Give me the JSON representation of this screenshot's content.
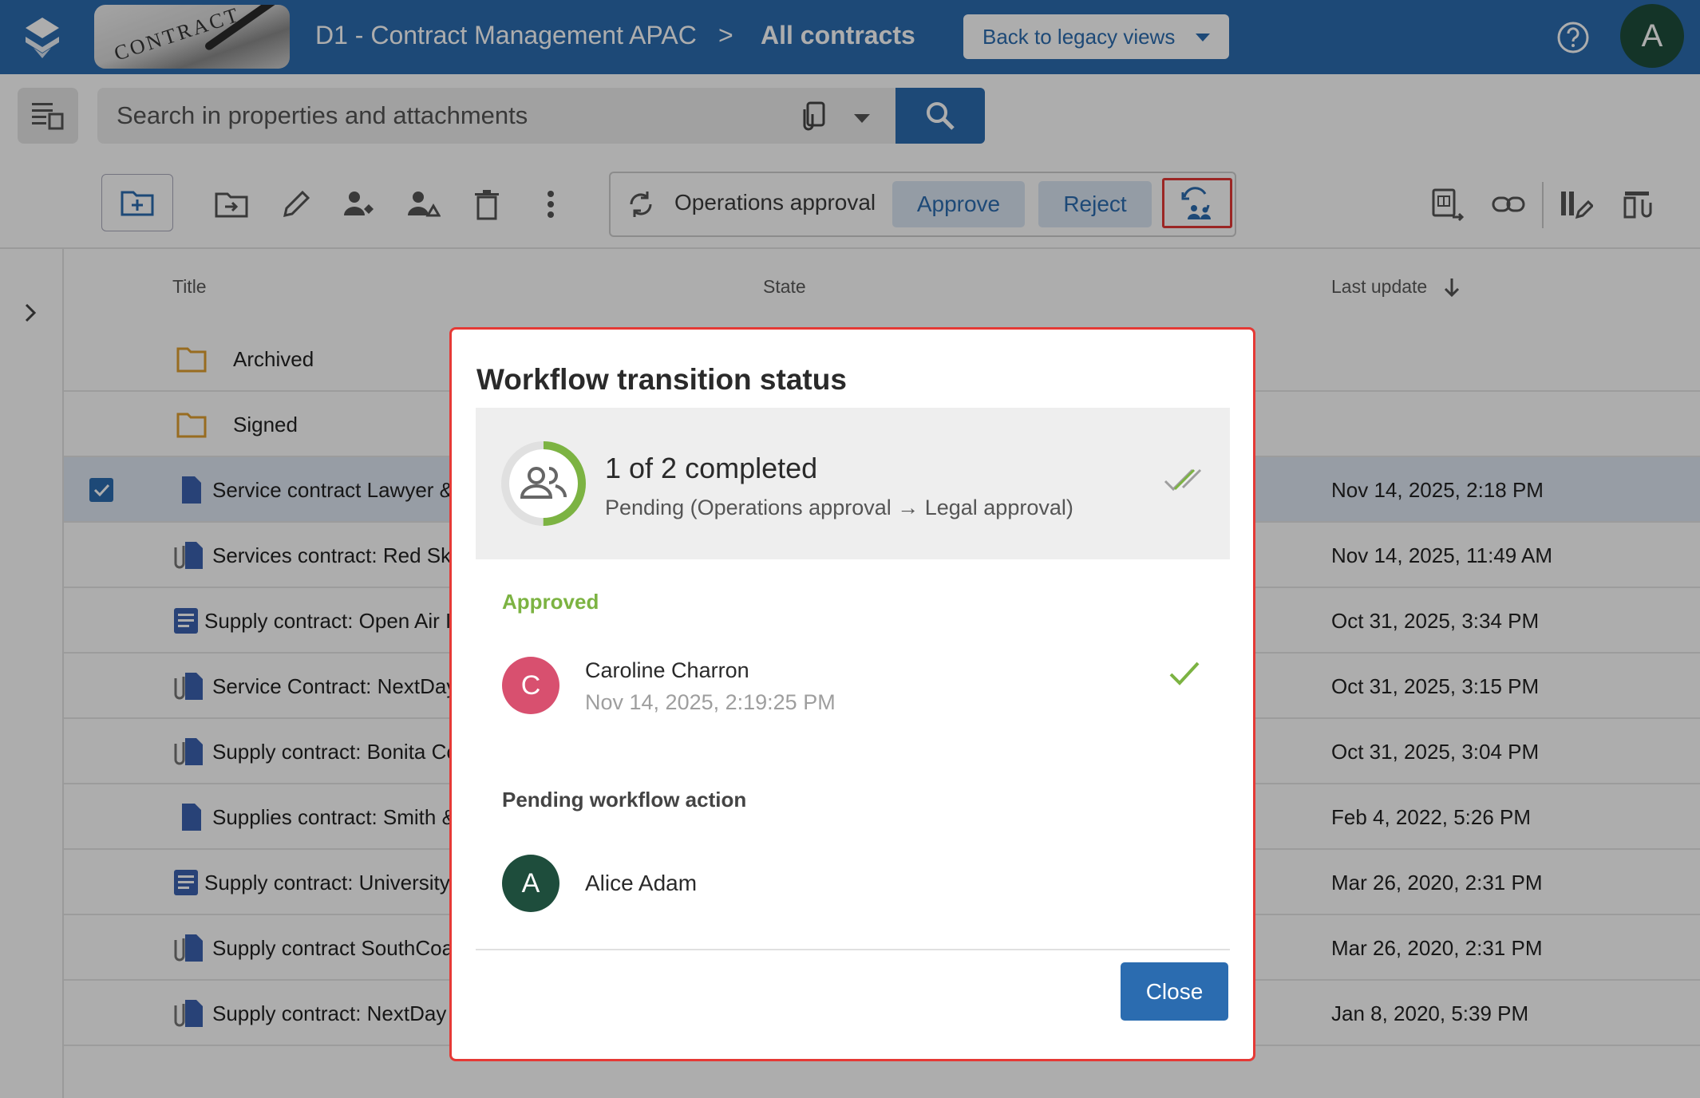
{
  "header": {
    "breadcrumb_parent": "D1 - Contract Management APAC",
    "breadcrumb_separator": ">",
    "breadcrumb_current": "All contracts",
    "legacy_button": "Back to legacy views",
    "banner_text": "CONTRACT",
    "user_initial": "A"
  },
  "search": {
    "placeholder": "Search in properties and attachments"
  },
  "workflow_toolbar": {
    "current_step": "Operations approval",
    "approve": "Approve",
    "reject": "Reject"
  },
  "table": {
    "columns": {
      "title": "Title",
      "state": "State",
      "last_update": "Last update"
    },
    "rows": [
      {
        "title": "Archived",
        "date": "",
        "type": "folder"
      },
      {
        "title": "Signed",
        "date": "",
        "type": "folder"
      },
      {
        "title": "Service contract Lawyer &",
        "date": "Nov 14, 2025, 2:18 PM",
        "type": "file"
      },
      {
        "title": "Services contract: Red Sky",
        "date": "Nov 14, 2025, 11:49 AM",
        "type": "attach"
      },
      {
        "title": "Supply contract: Open Air I",
        "date": "Oct 31, 2025, 3:34 PM",
        "type": "doc"
      },
      {
        "title": "Service Contract: NextDay",
        "date": "Oct 31, 2025, 3:15 PM",
        "type": "attach"
      },
      {
        "title": "Supply contract: Bonita Co",
        "date": "Oct 31, 2025, 3:04 PM",
        "type": "attach"
      },
      {
        "title": "Supplies contract: Smith &",
        "date": "Feb 4, 2022, 5:26 PM",
        "type": "file"
      },
      {
        "title": "Supply contract: University",
        "date": "Mar 26, 2020, 2:31 PM",
        "type": "doc"
      },
      {
        "title": "Supply contract SouthCoas",
        "date": "Mar 26, 2020, 2:31 PM",
        "type": "attach"
      },
      {
        "title": "Supply contract: NextDay",
        "date": "Jan 8, 2020, 5:39 PM",
        "type": "attach"
      }
    ]
  },
  "dialog": {
    "title": "Workflow transition status",
    "summary_count": "1 of 2 completed",
    "summary_status": "Pending  (Operations approval → Legal approval)",
    "completed_fraction": 0.5,
    "approved_heading": "Approved",
    "approver": {
      "initial": "C",
      "name": "Caroline Charron",
      "date": "Nov 14, 2025, 2:19:25 PM"
    },
    "pending_heading": "Pending workflow action",
    "pending_user": {
      "initial": "A",
      "name": "Alice Adam"
    },
    "close": "Close"
  },
  "colors": {
    "brand": "#2b6cb0",
    "approved_green": "#7cb342",
    "highlight_red": "#e53935",
    "avatar_c": "#d8506f",
    "avatar_a": "#1e4d3c",
    "folder": "#e0a030",
    "file_blue": "#3b62b0"
  }
}
